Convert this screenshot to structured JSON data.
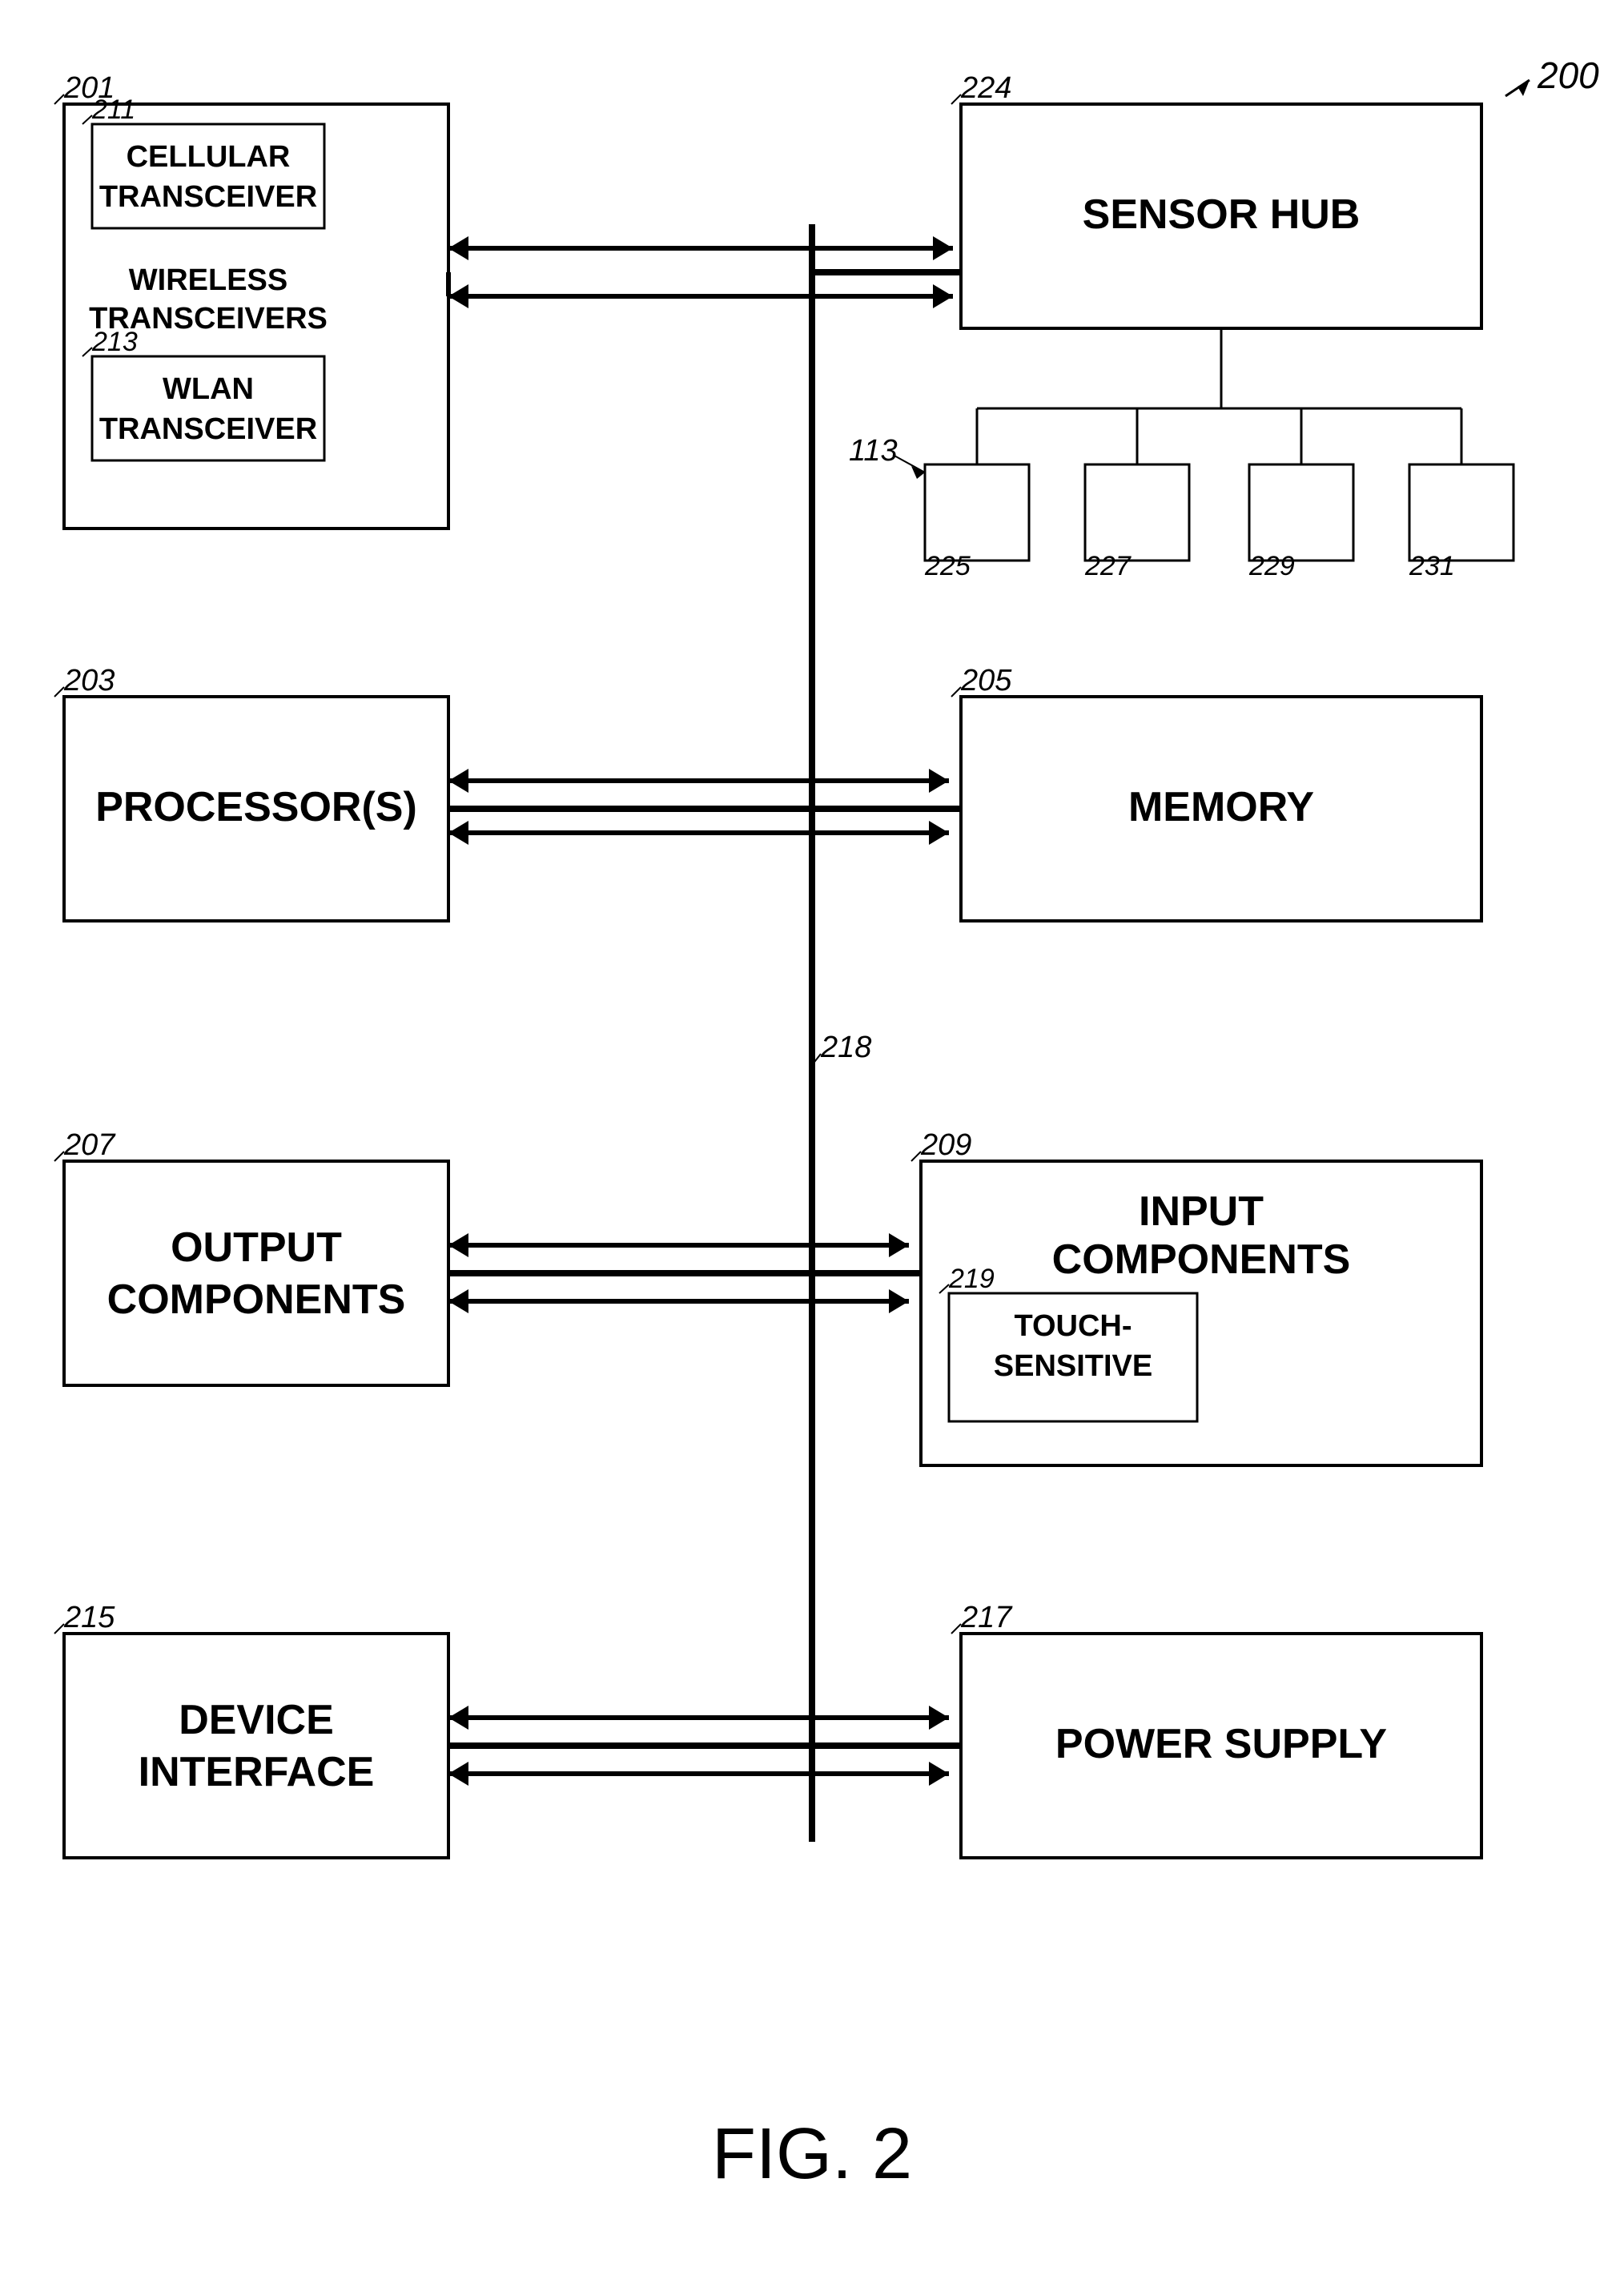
{
  "diagram": {
    "title": "FIG. 2",
    "figure_number": "200",
    "blocks": {
      "wireless_transceivers": {
        "label": "201",
        "inner_cellular": {
          "label": "211",
          "text": "CELLULAR\nTRANSCEIVER"
        },
        "middle_text": "WIRELESS\nTRANSCEIVERS",
        "inner_wlan": {
          "label": "213",
          "text": "WLAN\nTRANSCEIVER"
        }
      },
      "sensor_hub": {
        "label": "224",
        "text": "SENSOR HUB"
      },
      "sensors": {
        "label": "113",
        "nodes": [
          "225",
          "227",
          "229",
          "231"
        ]
      },
      "processor": {
        "label": "203",
        "text": "PROCESSOR(S)"
      },
      "memory": {
        "label": "205",
        "text": "MEMORY"
      },
      "output_components": {
        "label": "207",
        "text": "OUTPUT\nCOMPONENTS"
      },
      "input_components": {
        "label": "209",
        "text": "INPUT\nCOMPONENTS",
        "inner_touch": {
          "label": "219",
          "text": "TOUCH-\nSENSITIVE"
        }
      },
      "device_interface": {
        "label": "215",
        "text": "DEVICE\nINTERFACE"
      },
      "power_supply": {
        "label": "217",
        "text": "POWER SUPPLY"
      },
      "bus_label": "218"
    }
  }
}
